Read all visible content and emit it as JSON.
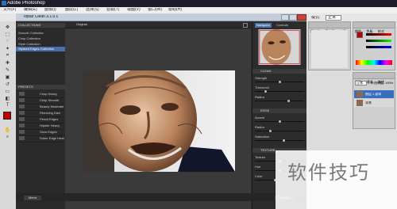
{
  "ps": {
    "title": "Adobe Photoshop",
    "menus": [
      "文件(F)",
      "编辑(E)",
      "图像(I)",
      "图层(L)",
      "选择(S)",
      "滤镜(T)",
      "视图(V)",
      "窗口(W)",
      "帮助(H)"
    ],
    "options": {
      "mode_label": "模式:",
      "mode_value": "正常"
    }
  },
  "topaz": {
    "title": "Topaz Clean 3.1.0.0",
    "left_panel": {
      "collections_header": "COLLECTIONS",
      "collections": [
        "Smooth Collection",
        "Crisp Collection",
        "Style Collection",
        "Stylized Edges Collection"
      ],
      "selected_collection_index": 3,
      "presets_header": "PRESETS",
      "presets": [
        "Crisp Heavy",
        "Crisp Smooth",
        "Beauty Moderate",
        "Rheaving Dark",
        "Pencil Edges",
        "Hipster Heavy",
        "Glow Edges",
        "Sober Edge Heat"
      ]
    },
    "canvas": {
      "tab_label": "Original"
    },
    "right_panel": {
      "tabs": [
        "Navigator",
        "Controls"
      ],
      "sections": [
        {
          "title": "CLEAN",
          "sliders": [
            {
              "label": "Strength",
              "value": 0.5
            },
            {
              "label": "Threshold",
              "value": 0.2
            },
            {
              "label": "Radius",
              "value": 0.7
            }
          ]
        },
        {
          "title": "EDGE",
          "sliders": [
            {
              "label": "Accent",
              "value": 0.5
            },
            {
              "label": "Radius",
              "value": 0.3
            },
            {
              "label": "Saturation",
              "value": 0.6
            }
          ]
        },
        {
          "title": "TEXTURE",
          "sliders": [
            {
              "label": "Texture",
              "value": 0.5
            },
            {
              "label": "Hue",
              "value": 0.5
            },
            {
              "label": "Color",
              "value": 0.4
            }
          ]
        }
      ]
    },
    "bottom": {
      "left_button": "Menu",
      "right_button": "Cancel"
    }
  },
  "ps_right": {
    "navigator_tab": "导航器",
    "histogram_tab": "直方图",
    "info_tab": "信息",
    "color_tab": "颜色",
    "swatches_tab": "色板",
    "styles_tab": "样式",
    "layers_tab": "图层",
    "channels_tab": "通道",
    "paths_tab": "路径",
    "blend_mode": "正常",
    "opacity_label": "不透明度:",
    "opacity_value": "100%",
    "layers": [
      "图层 1 副本",
      "背景"
    ]
  },
  "watermark": {
    "text": "软件技巧"
  },
  "colors": {
    "accent": "#4a6ea8",
    "foreground": "#c00000",
    "panel_dark": "#2d2d2d"
  }
}
